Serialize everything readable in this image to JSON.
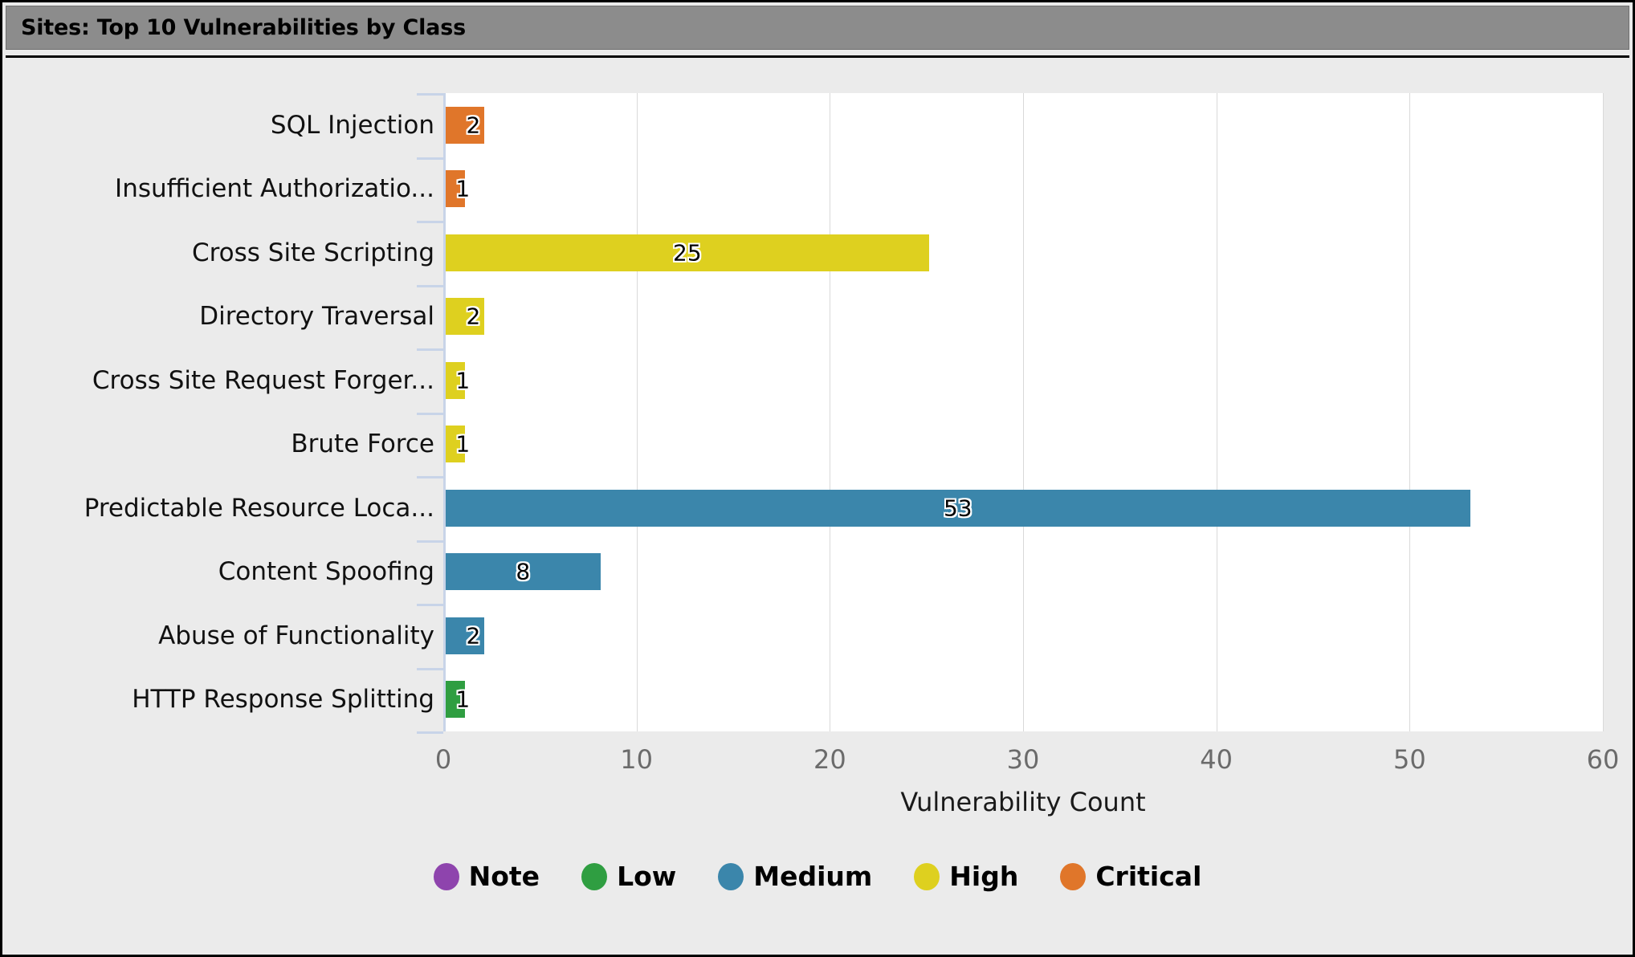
{
  "window": {
    "title": "Sites: Top 10 Vulnerabilities by Class"
  },
  "colors": {
    "note": "#8e44ad",
    "low": "#2f9e41",
    "medium": "#3b86ab",
    "high": "#ded01f",
    "critical": "#e0762a",
    "panel_background": "#ebebeb",
    "plot_background": "#ffffff",
    "title_bar_background": "#8c8c8c",
    "gridline": "#d9d9d9",
    "axis_spine": "#c8d4e8",
    "tick_label": "#6b6b6b"
  },
  "chart_data": {
    "type": "bar",
    "orientation": "horizontal",
    "title": "Sites: Top 10 Vulnerabilities by Class",
    "xlabel": "Vulnerability Count",
    "ylabel": "",
    "xlim": [
      0,
      60
    ],
    "xticks": [
      0,
      10,
      20,
      30,
      40,
      50,
      60
    ],
    "xticklabels": [
      "0",
      "10",
      "20",
      "30",
      "40",
      "50",
      "60"
    ],
    "grid": "vertical",
    "legend_position": "bottom",
    "categories": [
      "SQL Injection",
      "Insufficient Authorizatio...",
      "Cross Site Scripting",
      "Directory Traversal",
      "Cross Site Request Forger...",
      "Brute Force",
      "Predictable Resource Loca...",
      "Content Spoofing",
      "Abuse of Functionality",
      "HTTP Response Splitting"
    ],
    "values": [
      2,
      1,
      25,
      2,
      1,
      1,
      53,
      8,
      2,
      1
    ],
    "severities": [
      "Critical",
      "Critical",
      "High",
      "High",
      "High",
      "High",
      "Medium",
      "Medium",
      "Medium",
      "Low"
    ],
    "bar_colors": [
      "#e0762a",
      "#e0762a",
      "#ded01f",
      "#ded01f",
      "#ded01f",
      "#ded01f",
      "#3b86ab",
      "#3b86ab",
      "#3b86ab",
      "#2f9e41"
    ],
    "data_labels": [
      "2",
      "1",
      "25",
      "2",
      "1",
      "1",
      "53",
      "8",
      "2",
      "1"
    ],
    "legend": [
      {
        "label": "Note",
        "color": "#8e44ad"
      },
      {
        "label": "Low",
        "color": "#2f9e41"
      },
      {
        "label": "Medium",
        "color": "#3b86ab"
      },
      {
        "label": "High",
        "color": "#ded01f"
      },
      {
        "label": "Critical",
        "color": "#e0762a"
      }
    ]
  }
}
